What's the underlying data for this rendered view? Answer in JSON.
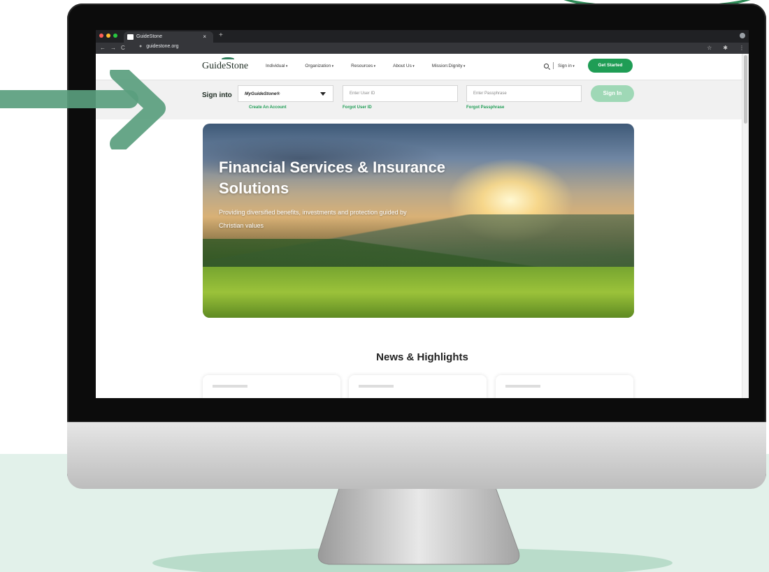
{
  "browser": {
    "tab_title": "GuideStone",
    "tab_close": "×",
    "new_tab": "+",
    "url": "guidestone.org",
    "nav_back": "←",
    "nav_forward": "→",
    "nav_reload": "C",
    "lock": "🔒",
    "star": "☆",
    "extensions": "✱",
    "menu": "⋮"
  },
  "header": {
    "logo": "GuideStone",
    "nav": [
      "Individual",
      "Organization",
      "Resources",
      "About Us",
      "Mission:Dignity"
    ],
    "sign_in_menu": "Sign in",
    "get_started": "Get Started"
  },
  "signin": {
    "label": "Sign into",
    "select_value": "MyGuideStone®",
    "create_account": "Create An Account",
    "user_id_placeholder": "Enter User ID",
    "forgot_user_id": "Forgot User ID",
    "passphrase_placeholder": "Enter Passphrase",
    "forgot_passphrase": "Forgot Passphrase",
    "button": "Sign In"
  },
  "hero": {
    "title": "Financial Services & Insurance Solutions",
    "subtitle": "Providing diversified benefits, investments and protection guided by Christian values"
  },
  "news": {
    "title": "News & Highlights"
  },
  "colors": {
    "brand_green": "#1f9d55",
    "signin_disabled": "#9fd8b6",
    "arrow_green": "#5a9e7e",
    "background_mint": "#e2f1ea"
  }
}
